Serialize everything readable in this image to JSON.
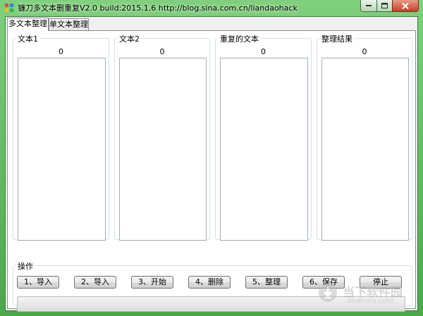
{
  "window": {
    "title": "镰刀多文本删重复V2.0  build:2015.1.6  http://blog.sina.com.cn/liandaohack",
    "colors": {
      "frame": "#6cc36a",
      "close_button": "#c4412a",
      "progress": "#06b025"
    }
  },
  "tabs": [
    {
      "label": "多文本整理",
      "active": true
    },
    {
      "label": "单文本整理",
      "active": false
    }
  ],
  "panels": [
    {
      "label": "文本1",
      "count": "0"
    },
    {
      "label": "文本2",
      "count": "0"
    },
    {
      "label": "重复的文本",
      "count": "0"
    },
    {
      "label": "整理结果",
      "count": "0"
    }
  ],
  "operations": {
    "label": "操作",
    "buttons": [
      "1、导入",
      "2、导入",
      "3、开始",
      "4、删除",
      "5、整理",
      "6、保存",
      "停止"
    ],
    "progress": 0
  },
  "watermark": {
    "title": "当下软件园",
    "subtitle": "downxia.com"
  }
}
